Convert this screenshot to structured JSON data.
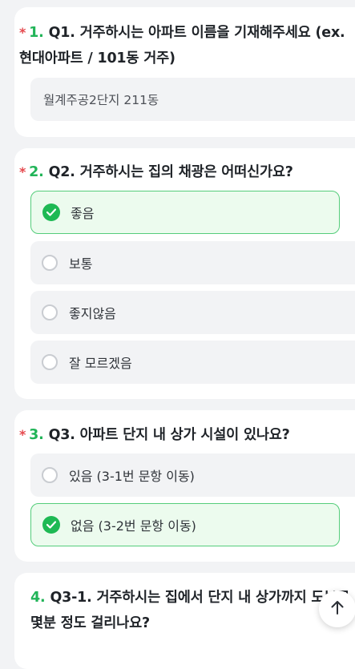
{
  "q1": {
    "required": "*",
    "number": "1.",
    "title_line1": "Q1. 거주하시는 아파트 이름을 기재해주세요 (ex.",
    "title_line2": "현대아파트 / 101동 거주)",
    "value": "월계주공2단지 211동"
  },
  "q2": {
    "required": "*",
    "number": "2.",
    "title": "Q2. 거주하시는 집의 채광은 어떠신가요?",
    "options": [
      {
        "label": "좋음",
        "selected": true
      },
      {
        "label": "보통",
        "selected": false
      },
      {
        "label": "좋지않음",
        "selected": false
      },
      {
        "label": "잘 모르겠음",
        "selected": false
      }
    ]
  },
  "q3": {
    "required": "*",
    "number": "3.",
    "title": "Q3. 아파트 단지 내 상가 시설이 있나요?",
    "options": [
      {
        "label": "있음 (3-1번 문항 이동)",
        "selected": false
      },
      {
        "label": "없음 (3-2번 문항 이동)",
        "selected": true
      }
    ]
  },
  "q4": {
    "number": "4.",
    "title_line1": "Q3-1. 거주하시는 집에서 단지 내 상가까지 도보로",
    "title_line2": "몇분 정도 걸리나요?"
  },
  "colors": {
    "accent": "#21b458",
    "required": "#e5484d",
    "selected_bg": "#ecfbee",
    "selected_border": "#55cd7b",
    "option_bg": "#f2f3f5"
  },
  "icons": {
    "check": "check-circle-icon",
    "radio": "radio-empty-icon",
    "scroll_top": "arrow-up-icon"
  }
}
